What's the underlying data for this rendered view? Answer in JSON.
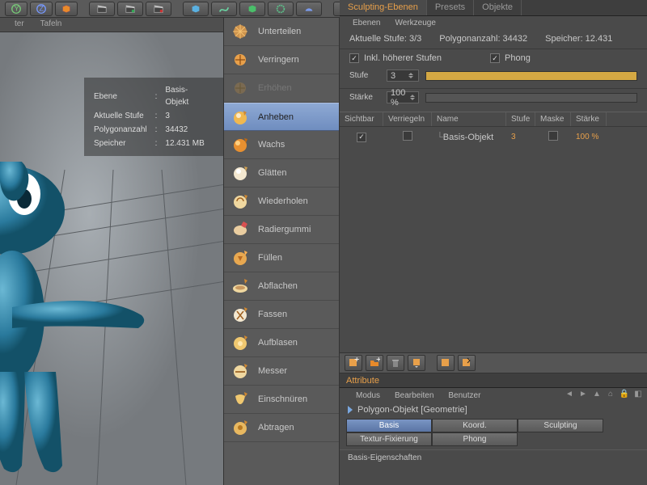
{
  "tabs_left": [
    "ter",
    "Tafeln"
  ],
  "overlay": {
    "r1a": "Ebene",
    "r1b": "Basis-Objekt",
    "r2a": "Aktuelle Stufe",
    "r2b": "3",
    "r3a": "Polygonanzahl",
    "r3b": "34432",
    "r4a": "Speicher",
    "r4b": "12.431 MB"
  },
  "tools": [
    {
      "label": "Unterteilen"
    },
    {
      "label": "Verringern"
    },
    {
      "label": "Erhöhen",
      "dim": true
    },
    {
      "label": "Anheben",
      "sel": true
    },
    {
      "label": "Wachs"
    },
    {
      "label": "Glätten"
    },
    {
      "label": "Wiederholen"
    },
    {
      "label": "Radiergummi"
    },
    {
      "label": "Füllen"
    },
    {
      "label": "Abflachen"
    },
    {
      "label": "Fassen"
    },
    {
      "label": "Aufblasen"
    },
    {
      "label": "Messer"
    },
    {
      "label": "Einschnüren"
    },
    {
      "label": "Abtragen"
    }
  ],
  "rtabs": [
    "Sculpting-Ebenen",
    "Presets",
    "Objekte"
  ],
  "subtabs": [
    "Ebenen",
    "Werkzeuge"
  ],
  "info": {
    "stufe": "Aktuelle Stufe: 3/3",
    "poly": "Polygonanzahl: 34432",
    "speicher": "Speicher:  12.431"
  },
  "chk1": "Inkl. höherer Stufen",
  "chk2": "Phong",
  "stufe_lbl": "Stufe",
  "stufe_val": "3",
  "staerke_lbl": "Stärke",
  "staerke_val": "100 %",
  "cols": {
    "c1": "Sichtbar",
    "c2": "Verriegeln",
    "c3": "Name",
    "c4": "Stufe",
    "c5": "Maske",
    "c6": "Stärke"
  },
  "row": {
    "name": "Basis-Objekt",
    "stufe": "3",
    "staerke": "100 %"
  },
  "attr": "Attribute",
  "attrsub": [
    "Modus",
    "Bearbeiten",
    "Benutzer"
  ],
  "obj": "Polygon-Objekt [Geometrie]",
  "pbtns": [
    "Basis",
    "Koord.",
    "Sculpting",
    "Textur-Fixierung",
    "Phong"
  ],
  "sect": "Basis-Eigenschaften"
}
